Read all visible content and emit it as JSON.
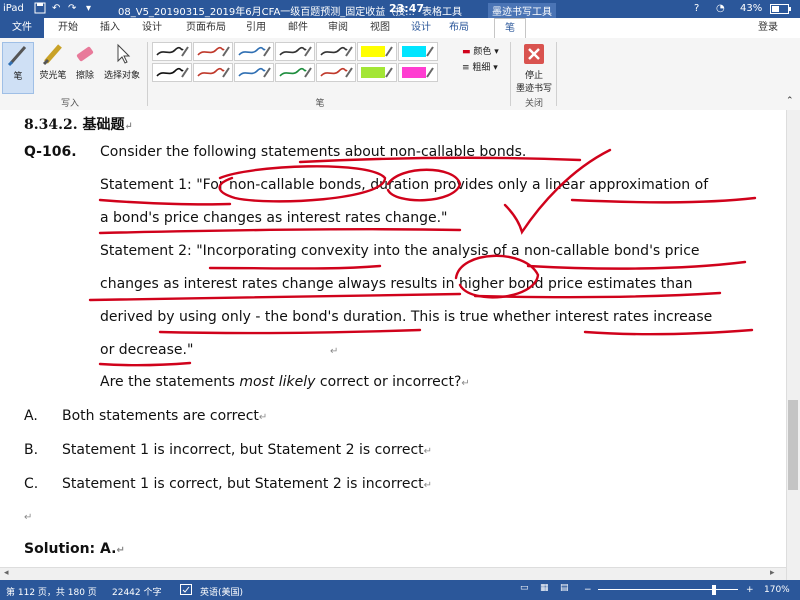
{
  "status": {
    "device": "iPad",
    "filename": "08_V5_20190315_2019年6月CFA一级百题预测_固定收益（授...",
    "time": "23:47",
    "context_tab_table": "表格工具",
    "context_tab_ink": "墨迹书写工具",
    "battery": "43%",
    "help": "?"
  },
  "tabs": {
    "file": "文件",
    "home": "开始",
    "insert": "插入",
    "design": "设计",
    "layout": "页面布局",
    "references": "引用",
    "mailings": "邮件",
    "review": "审阅",
    "view": "视图",
    "table_design": "设计",
    "table_layout": "布局",
    "pen": "笔",
    "login": "登录"
  },
  "ribbon": {
    "write_group": {
      "label": "写入",
      "pen": "笔",
      "highlighter": "荧光笔",
      "eraser": "擦除",
      "select": "选择对象"
    },
    "pens_group": {
      "label": "笔",
      "swatches": [
        {
          "color": "#222222",
          "type": "pen"
        },
        {
          "color": "#c0392b",
          "type": "pen"
        },
        {
          "color": "#2f6fb3",
          "type": "pen"
        },
        {
          "color": "#333333",
          "type": "pen"
        },
        {
          "color": "#333333",
          "type": "pen"
        },
        {
          "color": "#ffff00",
          "type": "highlighter"
        },
        {
          "color": "#00e5ff",
          "type": "highlighter"
        },
        {
          "color": "#111111",
          "type": "pen"
        },
        {
          "color": "#c0392b",
          "type": "pen"
        },
        {
          "color": "#2f6fb3",
          "type": "pen"
        },
        {
          "color": "#1e8e3e",
          "type": "pen"
        },
        {
          "color": "#c0392b",
          "type": "pen"
        },
        {
          "color": "#a3e635",
          "type": "highlighter"
        },
        {
          "color": "#ff3dd1",
          "type": "highlighter"
        }
      ],
      "color_label": "颜色",
      "thickness_label": "粗细"
    },
    "close_group": {
      "label": "关闭",
      "stop_line1": "停止",
      "stop_line2": "墨迹书写"
    }
  },
  "document": {
    "heading": "8.34.2.  基础题",
    "q_label": "Q-106.",
    "q_intro": "Consider the following statements about non-callable bonds.",
    "s1_line1": "Statement 1: \"For non-callable bonds, duration provides only a linear approximation of",
    "s1_line2": "a bond's price changes as interest rates change.\"",
    "s2_line1": "Statement 2: \"Incorporating convexity into the analysis of a non-callable bond's price",
    "s2_line2": "changes as interest rates change always results in higher bond price estimates than",
    "s2_line3": "derived by using only - the bond's duration. This is true whether interest rates increase",
    "s2_line4": "or decrease.\"",
    "question_pre": "Are the statements ",
    "question_em": "most likely",
    "question_post": " correct or incorrect?",
    "options": [
      {
        "letter": "A.",
        "text": "Both statements are correct"
      },
      {
        "letter": "B.",
        "text": "Statement 1 is incorrect, but Statement 2 is correct"
      },
      {
        "letter": "C.",
        "text": "Statement 1 is correct, but Statement 2 is incorrect"
      }
    ],
    "solution": "Solution: A.",
    "para_mark": "↵"
  },
  "footer": {
    "page": "第 112 页，共 180 页",
    "words": "22442 个字",
    "lang": "英语(美国)",
    "zoom": "170%",
    "zoom_minus": "−",
    "zoom_plus": "+"
  },
  "ink_color": "#d0021b"
}
